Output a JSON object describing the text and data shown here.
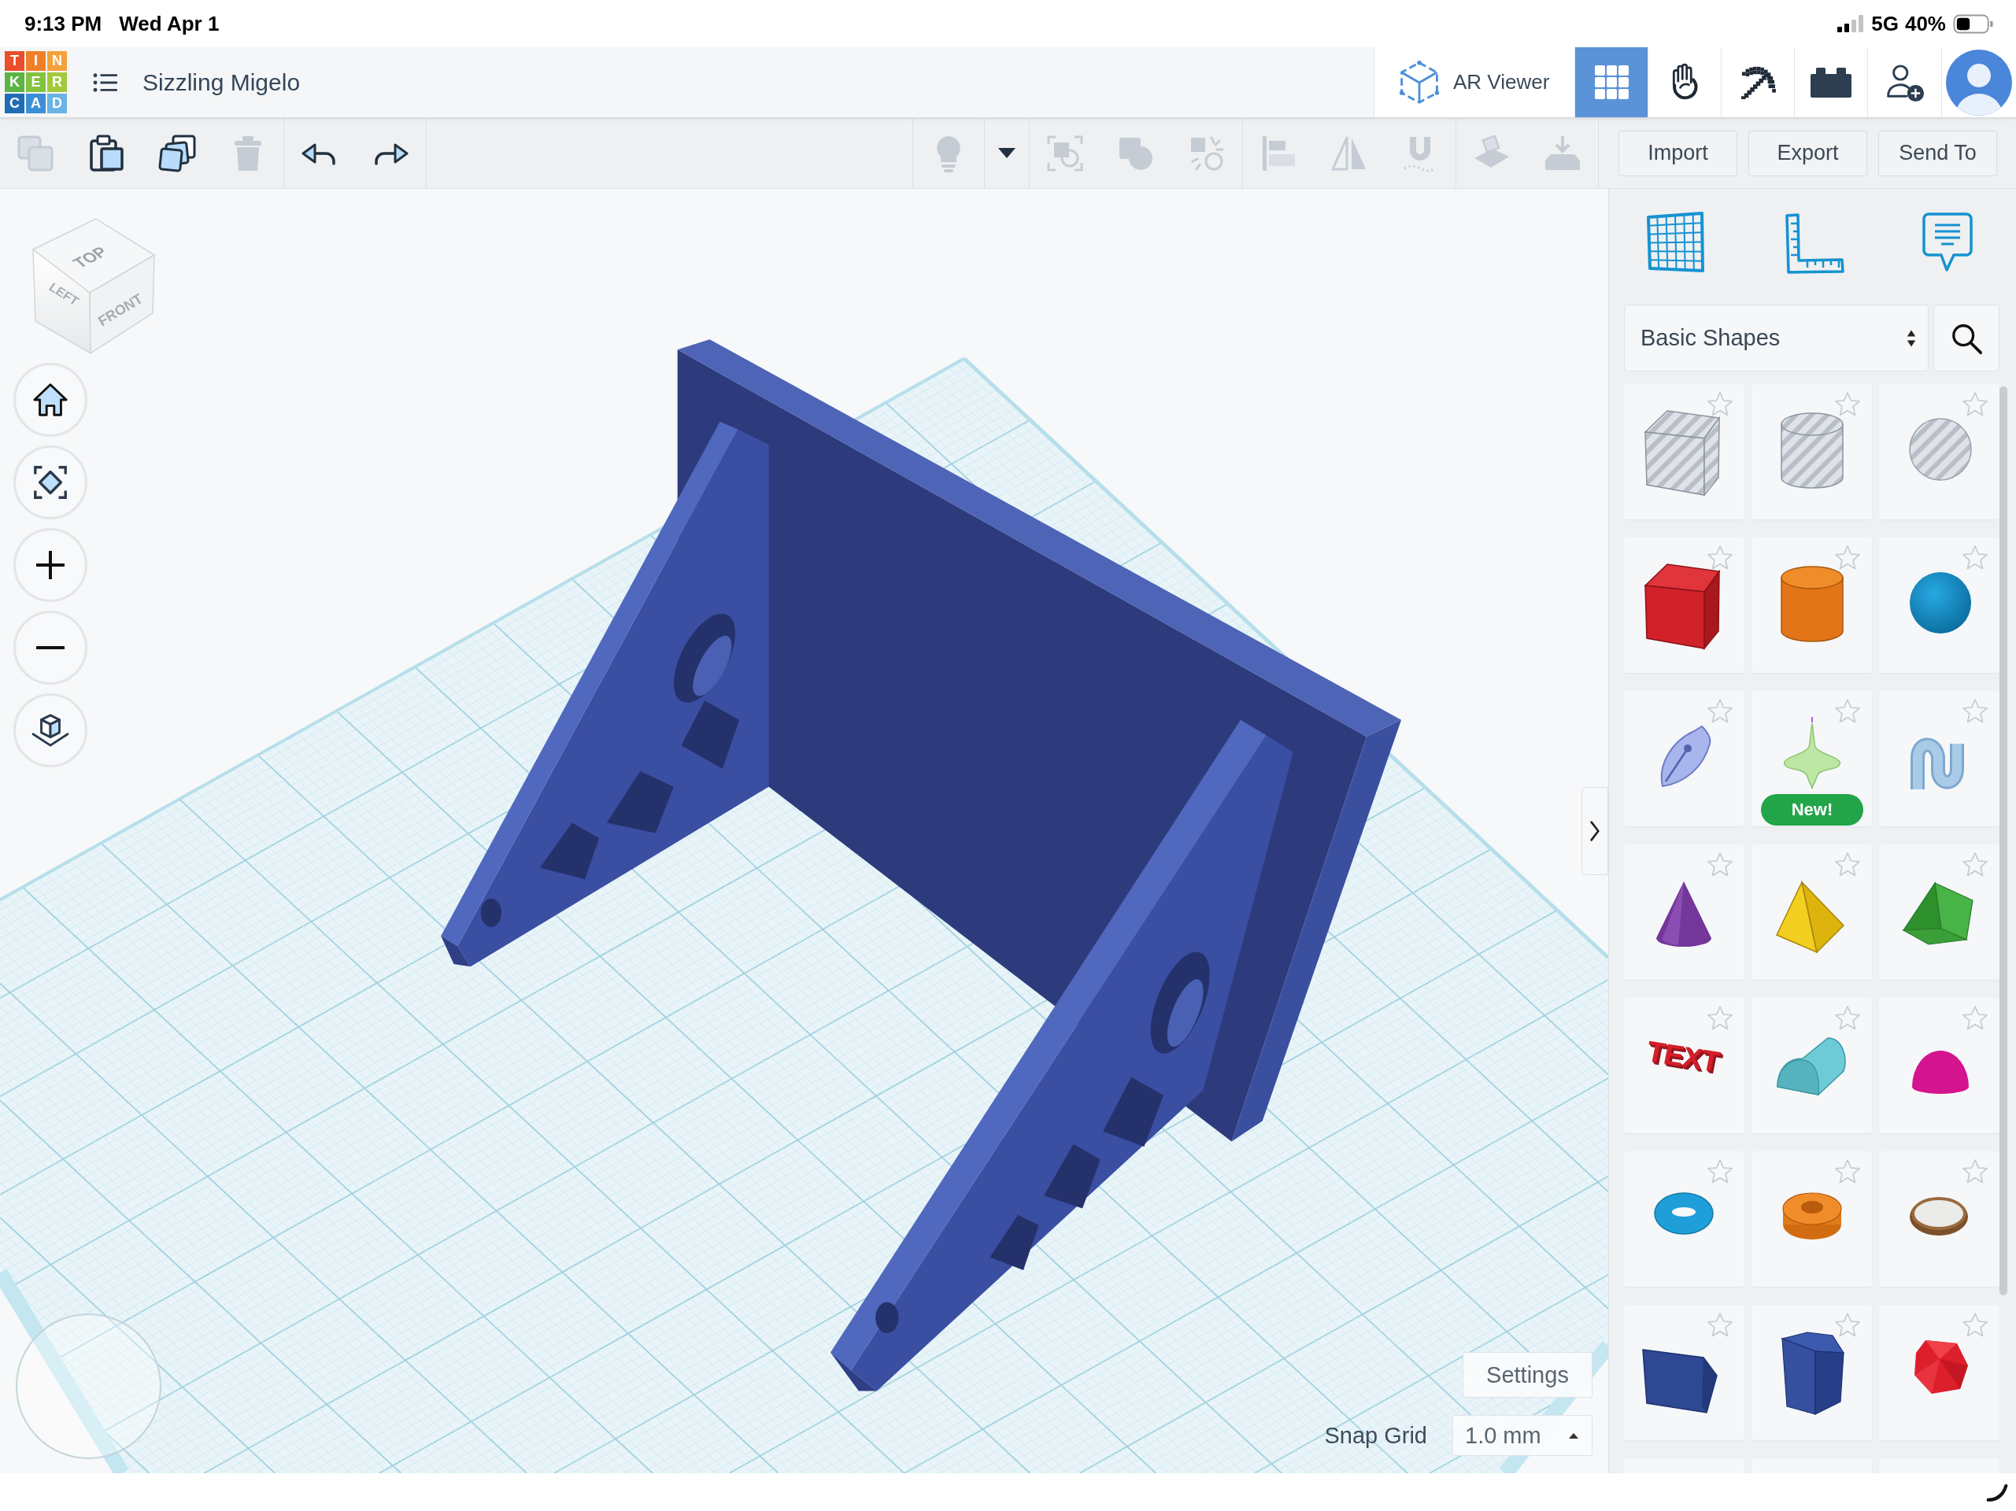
{
  "status_bar": {
    "time": "9:13 PM",
    "date": "Wed Apr 1",
    "network": "5G",
    "battery": "40%"
  },
  "header": {
    "logo": [
      {
        "letter": "T",
        "color": "#e84f2a"
      },
      {
        "letter": "I",
        "color": "#f07f29"
      },
      {
        "letter": "N",
        "color": "#f5a13b"
      },
      {
        "letter": "K",
        "color": "#5db446"
      },
      {
        "letter": "E",
        "color": "#84c342"
      },
      {
        "letter": "R",
        "color": "#a3c93d"
      },
      {
        "letter": "C",
        "color": "#1f6db5"
      },
      {
        "letter": "A",
        "color": "#3b8fd7"
      },
      {
        "letter": "D",
        "color": "#6ab3e4"
      }
    ],
    "title": "Sizzling Migelo",
    "ar_viewer": "AR Viewer",
    "view_tabs": [
      {
        "kind": "grid",
        "selected": true
      },
      {
        "kind": "hand",
        "selected": false
      },
      {
        "kind": "pickaxe",
        "selected": false
      },
      {
        "kind": "bricks",
        "selected": false
      }
    ]
  },
  "toolbar": {
    "left_groups": [
      [
        {
          "kind": "copy",
          "disabled": true
        },
        {
          "kind": "paste",
          "disabled": false
        },
        {
          "kind": "duplicate",
          "disabled": false
        },
        {
          "kind": "delete",
          "disabled": true
        }
      ],
      [
        {
          "kind": "undo",
          "disabled": false
        },
        {
          "kind": "redo",
          "disabled": false
        }
      ]
    ],
    "right_groups": [
      [
        {
          "kind": "light",
          "disabled": true
        }
      ],
      [
        {
          "kind": "dropdown",
          "disabled": false
        }
      ],
      [
        {
          "kind": "group",
          "disabled": true
        },
        {
          "kind": "solid",
          "disabled": true
        },
        {
          "kind": "hole",
          "disabled": true
        }
      ],
      [
        {
          "kind": "align",
          "disabled": true
        },
        {
          "kind": "mirror",
          "disabled": true
        },
        {
          "kind": "cruise",
          "disabled": true
        }
      ],
      [
        {
          "kind": "workplane",
          "disabled": true
        },
        {
          "kind": "drop",
          "disabled": true
        }
      ]
    ],
    "actions": [
      "Import",
      "Export",
      "Send To"
    ]
  },
  "viewport": {
    "view_cube": [
      "TOP",
      "LEFT",
      "FRONT"
    ],
    "settings": "Settings",
    "snap_grid": {
      "label": "Snap Grid",
      "value": "1.0 mm"
    }
  },
  "shapes_panel": {
    "category": "Basic Shapes",
    "shapes": [
      {
        "kind": "box-hole",
        "starred": false
      },
      {
        "kind": "cylinder-hole",
        "starred": false
      },
      {
        "kind": "sphere-hole",
        "starred": false
      },
      {
        "kind": "box",
        "starred": false
      },
      {
        "kind": "cylinder",
        "starred": false
      },
      {
        "kind": "sphere",
        "starred": false
      },
      {
        "kind": "scribble",
        "starred": false
      },
      {
        "kind": "spinner",
        "starred": false,
        "badge": "New!"
      },
      {
        "kind": "squiggle",
        "starred": false
      },
      {
        "kind": "cone",
        "starred": false
      },
      {
        "kind": "pyramid",
        "starred": false
      },
      {
        "kind": "roof",
        "starred": false
      },
      {
        "kind": "text",
        "starred": false,
        "thumbnail_text": "TEXT"
      },
      {
        "kind": "round-roof",
        "starred": false
      },
      {
        "kind": "half-sphere",
        "starred": false
      },
      {
        "kind": "torus",
        "starred": false
      },
      {
        "kind": "tube",
        "starred": false
      },
      {
        "kind": "ring",
        "starred": false
      },
      {
        "kind": "pentagon-prism",
        "starred": false
      },
      {
        "kind": "hexagon-prism",
        "starred": false
      },
      {
        "kind": "icosahedron",
        "starred": false
      },
      {
        "kind": "cut-off"
      },
      {
        "kind": "cut-off"
      },
      {
        "kind": "cut-off"
      }
    ]
  }
}
